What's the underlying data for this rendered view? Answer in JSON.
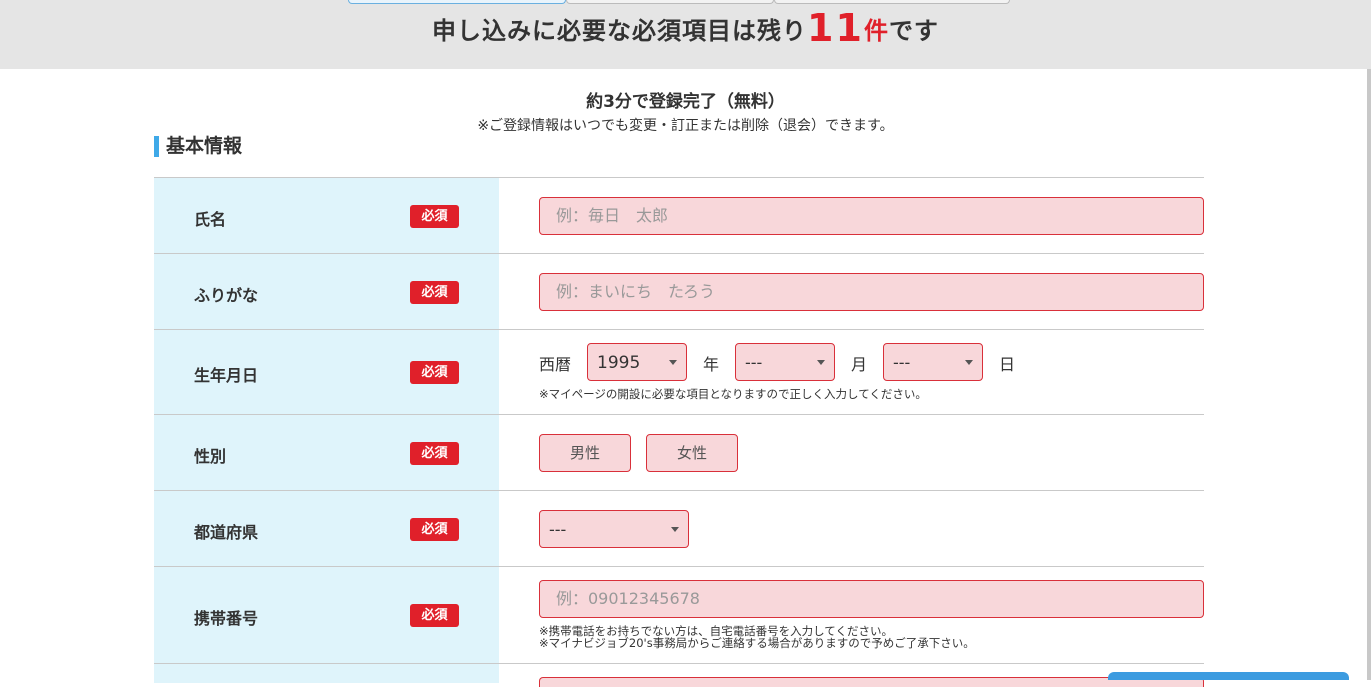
{
  "header": {
    "headline_prefix": "申し込みに必要な必須項目は残り",
    "remaining_count": "11",
    "remaining_unit": "件",
    "headline_suffix": "です"
  },
  "intro": {
    "subtitle": "約3分で登録完了（無料）",
    "note": "※ご登録情報はいつでも変更・訂正または削除（退会）できます。"
  },
  "section": {
    "title": "基本情報"
  },
  "required_label": "必須",
  "fields": {
    "name": {
      "label": "氏名",
      "placeholder": "例：毎日　太郎"
    },
    "kana": {
      "label": "ふりがな",
      "placeholder": "例：まいにち　たろう"
    },
    "birthday": {
      "label": "生年月日",
      "era_label": "西暦",
      "year_value": "1995",
      "year_unit": "年",
      "month_value": "---",
      "month_unit": "月",
      "day_value": "---",
      "day_unit": "日",
      "note": "※マイページの開設に必要な項目となりますので正しく入力してください。"
    },
    "gender": {
      "label": "性別",
      "male": "男性",
      "female": "女性"
    },
    "prefecture": {
      "label": "都道府県",
      "value": "---"
    },
    "mobile": {
      "label": "携帯番号",
      "placeholder": "例：09012345678",
      "note1": "※携帯電話をお持ちでない方は、自宅電話番号を入力してください。",
      "note2": "※マイナビジョブ20's事務局からご連絡する場合がありますので予めご了承下さい。"
    }
  },
  "colors": {
    "accent": "#e0202a",
    "section_bar": "#3fa9e8",
    "label_bg": "#dff4fb",
    "input_bg": "#f8d7da"
  }
}
